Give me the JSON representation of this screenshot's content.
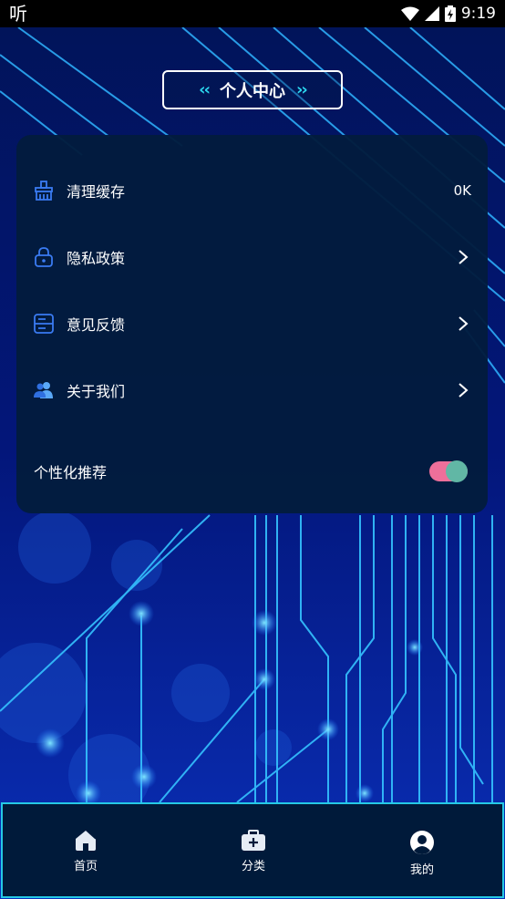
{
  "status_bar": {
    "app_glyph": "听",
    "time": "9:19",
    "icons": [
      "wifi-icon",
      "signal-icon",
      "battery-icon"
    ]
  },
  "header": {
    "title": "个人中心",
    "left_deco": "‹‹",
    "right_deco": "››"
  },
  "settings": {
    "items": [
      {
        "label": "清理缓存",
        "value": "0K",
        "icon": "broom-icon"
      },
      {
        "label": "隐私政策",
        "icon": "lock-icon"
      },
      {
        "label": "意见反馈",
        "icon": "feedback-icon"
      },
      {
        "label": "关于我们",
        "icon": "users-icon"
      }
    ],
    "personalized": {
      "label": "个性化推荐",
      "enabled": true
    }
  },
  "bottom_nav": {
    "items": [
      {
        "label": "首页",
        "icon": "home-icon"
      },
      {
        "label": "分类",
        "icon": "category-icon"
      },
      {
        "label": "我的",
        "icon": "profile-icon"
      }
    ]
  },
  "colors": {
    "accent": "#2bd7ee",
    "toggle_on": "#ee6f9a",
    "toggle_knob": "#61b7a5",
    "card": "#021c3d",
    "icon_blue": "#3a7bf2"
  }
}
